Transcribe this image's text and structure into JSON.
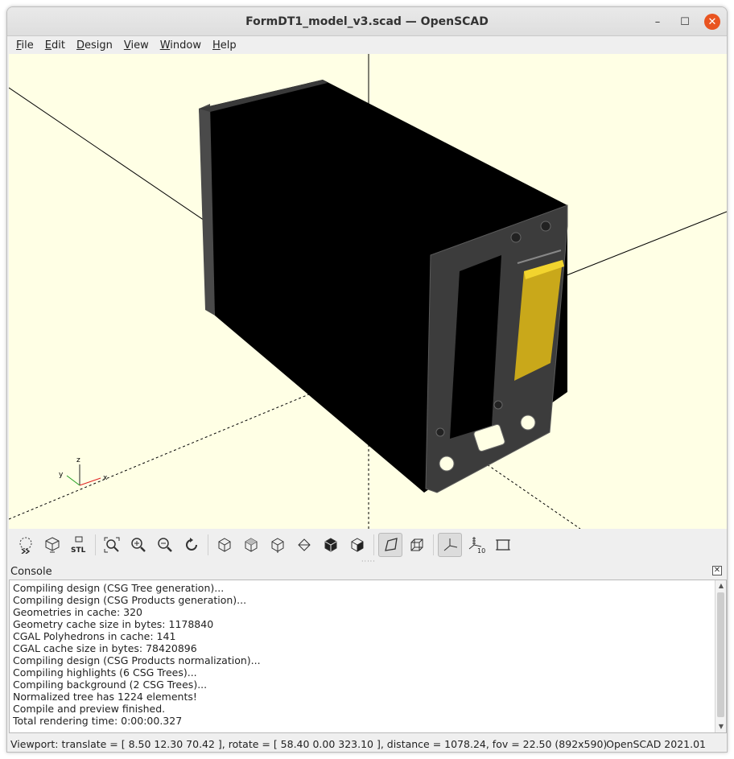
{
  "window": {
    "title": "FormDT1_model_v3.scad — OpenSCAD",
    "minimize_glyph": "–",
    "maximize_glyph": "☐",
    "close_glyph": "✕"
  },
  "menubar": {
    "items": [
      {
        "label": "File",
        "mnemonic": "F",
        "rest": "ile"
      },
      {
        "label": "Edit",
        "mnemonic": "E",
        "rest": "dit"
      },
      {
        "label": "Design",
        "mnemonic": "D",
        "rest": "esign"
      },
      {
        "label": "View",
        "mnemonic": "V",
        "rest": "iew"
      },
      {
        "label": "Window",
        "mnemonic": "W",
        "rest": "indow"
      },
      {
        "label": "Help",
        "mnemonic": "H",
        "rest": "elp"
      }
    ]
  },
  "viewport": {
    "background": "#ffffe5",
    "model_color": "#000000",
    "panel_color": "#3c3c3c",
    "highlight_color": "#e8c620",
    "axis_labels": {
      "x": "x",
      "y": "y",
      "z": "z"
    }
  },
  "toolbar": {
    "buttons": [
      {
        "name": "preview-button",
        "icon": "preview-icon",
        "active": false
      },
      {
        "name": "render-button",
        "icon": "render-icon",
        "active": false
      },
      {
        "name": "export-stl-button",
        "icon": "stl-icon",
        "label": "STL",
        "active": false
      },
      {
        "name": "view-all-button",
        "icon": "view-all-icon",
        "active": false
      },
      {
        "name": "zoom-in-button",
        "icon": "zoom-in-icon",
        "active": false
      },
      {
        "name": "zoom-out-button",
        "icon": "zoom-out-icon",
        "active": false
      },
      {
        "name": "reset-view-button",
        "icon": "reset-view-icon",
        "active": false
      },
      {
        "name": "view-right-button",
        "icon": "view-right-icon",
        "active": false
      },
      {
        "name": "view-top-button",
        "icon": "view-top-icon",
        "active": false
      },
      {
        "name": "view-bottom-button",
        "icon": "view-bottom-icon",
        "active": false
      },
      {
        "name": "view-left-button",
        "icon": "view-left-icon",
        "active": false
      },
      {
        "name": "view-front-button",
        "icon": "view-front-icon",
        "active": false
      },
      {
        "name": "view-back-button",
        "icon": "view-back-icon",
        "active": false
      },
      {
        "name": "perspective-button",
        "icon": "perspective-icon",
        "active": true
      },
      {
        "name": "orthogonal-button",
        "icon": "orthogonal-icon",
        "active": false
      },
      {
        "name": "show-axes-button",
        "icon": "axes-icon",
        "active": true
      },
      {
        "name": "show-scale-button",
        "icon": "scale-markers-icon",
        "label": "10",
        "active": false
      },
      {
        "name": "show-edges-button",
        "icon": "edges-icon",
        "active": false
      }
    ]
  },
  "console": {
    "title": "Console",
    "close_glyph": "✕",
    "lines": [
      "Compiling design (CSG Tree generation)...",
      "Compiling design (CSG Products generation)...",
      "Geometries in cache: 320",
      "Geometry cache size in bytes: 1178840",
      "CGAL Polyhedrons in cache: 141",
      "CGAL cache size in bytes: 78420896",
      "Compiling design (CSG Products normalization)...",
      "Compiling highlights (6 CSG Trees)...",
      "Compiling background (2 CSG Trees)...",
      "Normalized tree has 1224 elements!",
      "Compile and preview finished.",
      "Total rendering time: 0:00:00.327"
    ]
  },
  "statusbar": {
    "viewport_info": "Viewport: translate = [ 8.50 12.30 70.42 ], rotate = [ 58.40 0.00 323.10 ], distance = 1078.24, fov = 22.50 (892x590)",
    "version": "OpenSCAD 2021.01"
  }
}
